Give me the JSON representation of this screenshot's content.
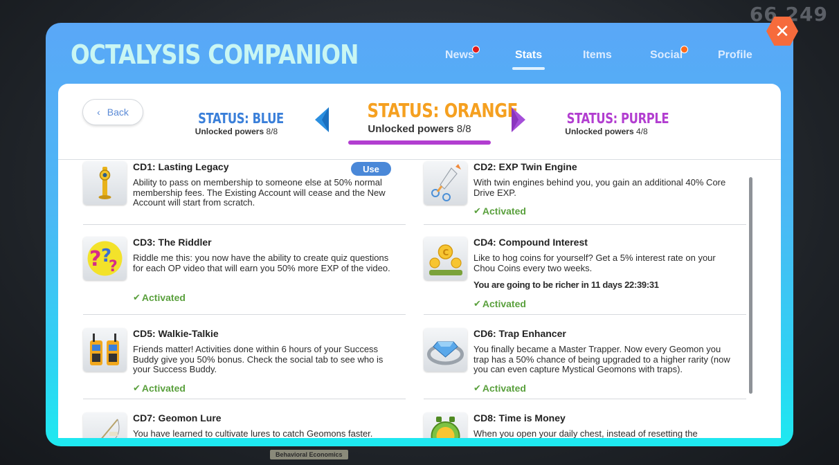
{
  "background": {
    "score": "66 249",
    "tag": "Behavioral Economics"
  },
  "modal": {
    "title": "OCTALYSIS COMPANION",
    "tabs": [
      {
        "label": "News",
        "active": false,
        "notification": true
      },
      {
        "label": "Stats",
        "active": true,
        "notification": false
      },
      {
        "label": "Items",
        "active": false,
        "notification": false
      },
      {
        "label": "Social",
        "active": false,
        "notification": true
      },
      {
        "label": "Profile",
        "active": false,
        "notification": false
      }
    ],
    "close_icon": "close-icon"
  },
  "panel": {
    "back_label": "Back",
    "status_prev": {
      "name": "STATUS: BLUE",
      "unlocked_label": "Unlocked powers",
      "count": "8/8"
    },
    "status_current": {
      "name": "STATUS: ORANGE",
      "unlocked_label": "Unlocked powers",
      "count": "8/8"
    },
    "status_next": {
      "name": "STATUS: PURPLE",
      "unlocked_label": "Unlocked powers",
      "count": "4/8"
    },
    "activated_label": "Activated",
    "use_label": "Use",
    "cards": [
      {
        "title": "CD1: Lasting Legacy",
        "desc": "Ability to pass on membership to someone else at 50% normal membership fees. The Existing Account will cease and the New Account will start from scratch.",
        "icon": "trophy-icon"
      },
      {
        "title": "CD2: EXP Twin Engine",
        "desc": "With twin engines behind you, you gain an additional 40% Core Drive EXP.",
        "icon": "rocket-icon"
      },
      {
        "title": "CD3: The Riddler",
        "desc": "Riddle me this: you now have the ability to create quiz questions for each OP video that will earn you 50% more EXP of the video.",
        "icon": "question-marks-icon"
      },
      {
        "title": "CD4: Compound Interest",
        "desc": "Like to hog coins for yourself? Get a 5% interest rate on your Chou Coins every two weeks.",
        "extra": "You are going to be richer in 11 days 22:39:31",
        "icon": "coin-flowers-icon"
      },
      {
        "title": "CD5: Walkie-Talkie",
        "desc": "Friends matter! Activities done within 6 hours of your Success Buddy give you 50% bonus. Check the social tab to see who is your Success Buddy.",
        "icon": "walkie-talkie-icon"
      },
      {
        "title": "CD6: Trap Enhancer",
        "desc": "You finally became a Master Trapper. Now every Geomon you trap has a 50% chance of being upgraded to a higher rarity (now you can even capture Mystical Geomons with traps).",
        "icon": "diamond-trap-icon"
      },
      {
        "title": "CD7: Geomon Lure",
        "desc": "You have learned to cultivate lures to catch Geomons faster.",
        "icon": "fishing-lure-icon"
      },
      {
        "title": "CD8: Time is Money",
        "desc": "When you open your daily chest, instead of resetting the",
        "icon": "clock-coin-icon"
      }
    ]
  },
  "colors": {
    "blue_status": "#3a7fd9",
    "orange_status": "#f5a020",
    "purple_status": "#b23ed0",
    "activated_green": "#5aa03d",
    "notification_red": "#e01b1b",
    "notification_orange": "#ff6a1a",
    "close_orange": "#f66b3c"
  }
}
